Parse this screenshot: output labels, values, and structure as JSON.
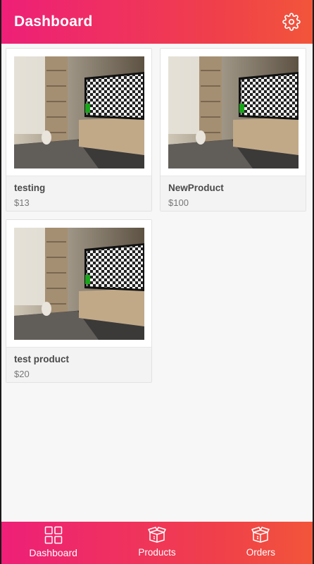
{
  "header": {
    "title": "Dashboard",
    "settings_icon": "gear-icon"
  },
  "products": [
    {
      "name": "testing",
      "price": "$13"
    },
    {
      "name": "NewProduct",
      "price": "$100"
    },
    {
      "name": "test product",
      "price": "$20"
    }
  ],
  "tabbar": {
    "tabs": [
      {
        "label": "Dashboard",
        "icon": "grid-icon",
        "active": true
      },
      {
        "label": "Products",
        "icon": "box-icon",
        "active": false
      },
      {
        "label": "Orders",
        "icon": "box-icon",
        "active": false
      }
    ]
  },
  "colors": {
    "accent_start": "#ee1f78",
    "accent_end": "#f2553a"
  }
}
